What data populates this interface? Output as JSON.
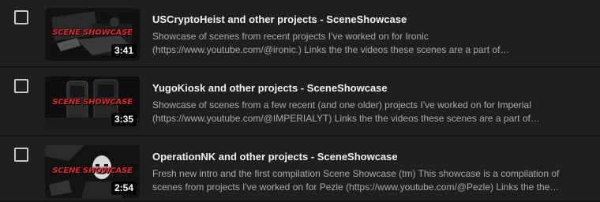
{
  "videos": [
    {
      "title": "USCryptoHeist and other projects - SceneShowcase",
      "description_line1": "Showcase of scenes from recent projects I've worked on for Ironic",
      "description_line2": "(https://www.youtube.com/@ironic.) Links the the videos these scenes are a part of…",
      "duration": "3:41",
      "thumbnail_text": "SCENE SHOWCASE",
      "selected": false
    },
    {
      "title": "YugoKiosk and other projects - SceneShowcase",
      "description_line1": "Showcase of scenes from a few recent (and one older) projects I've worked on for Imperial",
      "description_line2": "(https://www.youtube.com/@IMPERIALYT) Links the the videos these scenes are a part of…",
      "duration": "3:35",
      "thumbnail_text": "SCENE SHOWCASE",
      "selected": false
    },
    {
      "title": "OperationNK and other projects - SceneShowcase",
      "description_line1": "Fresh new intro and the first compilation Scene Showcase (tm) This showcase is a compilation of",
      "description_line2": "scenes from projects I've worked on for Pezle (https://www.youtube.com/@Pezle) Links the the…",
      "duration": "2:54",
      "thumbnail_text": "SCENE SHOWCASE",
      "selected": false
    }
  ],
  "colors": {
    "thumbnail_accent": "#e0262b",
    "background": "#1f1f1f"
  }
}
